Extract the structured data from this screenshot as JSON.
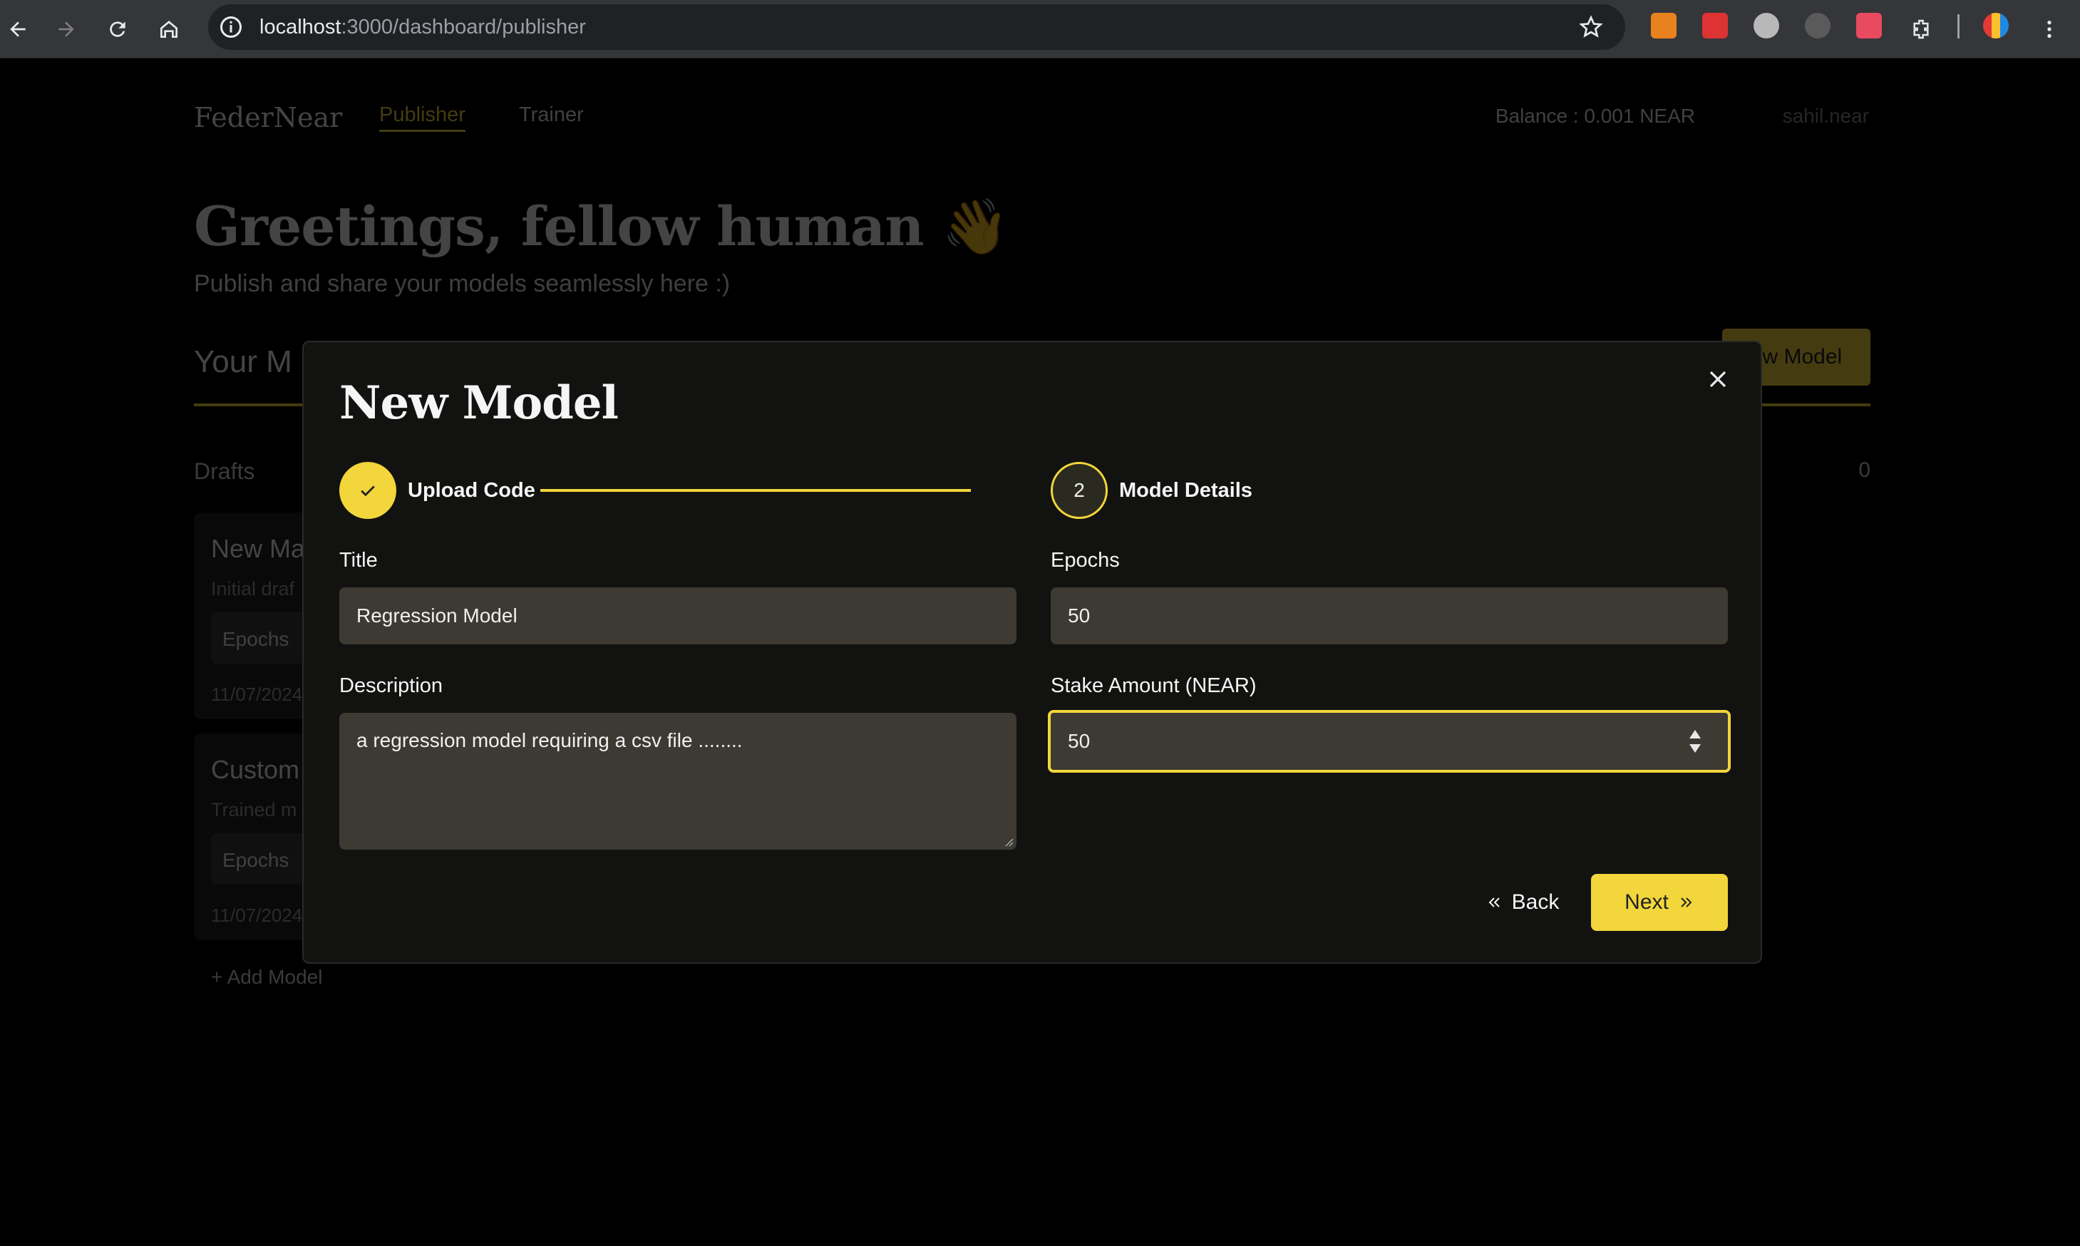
{
  "browser": {
    "url_host": "localhost",
    "url_path": ":3000/dashboard/publisher"
  },
  "page": {
    "logo": "FederNear",
    "nav": [
      {
        "label": "Publisher",
        "active": true
      },
      {
        "label": "Trainer",
        "active": false
      }
    ],
    "balance": "Balance : 0.001 NEAR",
    "account": "sahil.near",
    "greeting": "Greetings, fellow human 👋",
    "subtitle": "Publish and share your models seamlessly here :)",
    "section_title": "Your M",
    "new_model_button": "ew Model",
    "drafts_label": "Drafts",
    "drafts_count": "0",
    "cards": [
      {
        "title": "New Ma",
        "subtitle": "Initial draf",
        "badge": "Epochs",
        "date": "11/07/2024"
      },
      {
        "title": "Custom",
        "subtitle": "Trained m",
        "badge": "Epochs",
        "date": "11/07/2024"
      }
    ],
    "add_model": "+ Add Model"
  },
  "modal": {
    "title": "New Model",
    "steps": [
      {
        "label": "Upload Code",
        "state": "complete"
      },
      {
        "label": "Model Details",
        "number": "2",
        "state": "current"
      }
    ],
    "fields": {
      "title": {
        "label": "Title",
        "value": "Regression Model"
      },
      "epochs": {
        "label": "Epochs",
        "value": "50"
      },
      "description": {
        "label": "Description",
        "value": "a regression model requiring a csv file ........"
      },
      "stake": {
        "label": "Stake Amount (NEAR)",
        "value": "50"
      }
    },
    "back_label": "Back",
    "next_label": "Next"
  },
  "colors": {
    "accent": "#f2d63b",
    "modal_bg": "#121210",
    "input_bg": "#3c3a33"
  }
}
